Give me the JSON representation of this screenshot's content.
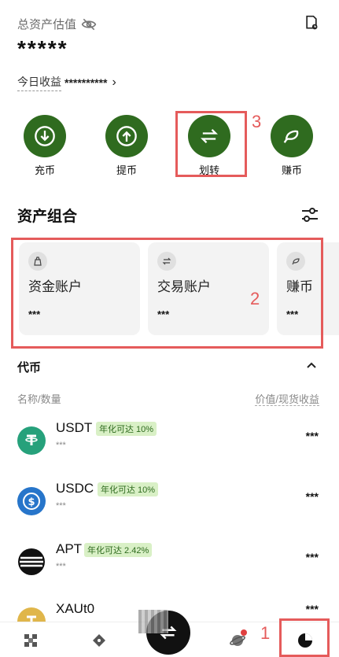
{
  "header": {
    "title": "总资产估值",
    "total_value": "*****",
    "today_label": "今日收益",
    "today_value": "**********"
  },
  "actions": [
    {
      "label": "充币"
    },
    {
      "label": "提币"
    },
    {
      "label": "划转"
    },
    {
      "label": "赚币"
    }
  ],
  "portfolio": {
    "title": "资产组合",
    "cards": [
      {
        "name": "资金账户",
        "value": "***"
      },
      {
        "name": "交易账户",
        "value": "***"
      },
      {
        "name": "赚币",
        "value": "***"
      }
    ]
  },
  "tokens": {
    "title": "代币",
    "col_left": "名称/数量",
    "col_right": "价值/现货收益",
    "rows": [
      {
        "symbol": "USDT",
        "badge": "年化可达 10%",
        "sub": "***",
        "value": "***",
        "color": "#26a17b"
      },
      {
        "symbol": "USDC",
        "badge": "年化可达 10%",
        "sub": "***",
        "value": "***",
        "color": "#2775ca"
      },
      {
        "symbol": "APT",
        "badge": "年化可达 2.42%",
        "sub": "***",
        "value": "***",
        "color": "#111111"
      },
      {
        "symbol": "XAUt0",
        "badge": "",
        "sub": "",
        "value": "***",
        "color": "#e0b64a"
      }
    ]
  },
  "annotations": [
    "1",
    "2",
    "3"
  ],
  "colors": {
    "accent": "#2f6b1f",
    "highlight": "#e55b5b",
    "badge_bg": "#d9f0c6"
  }
}
